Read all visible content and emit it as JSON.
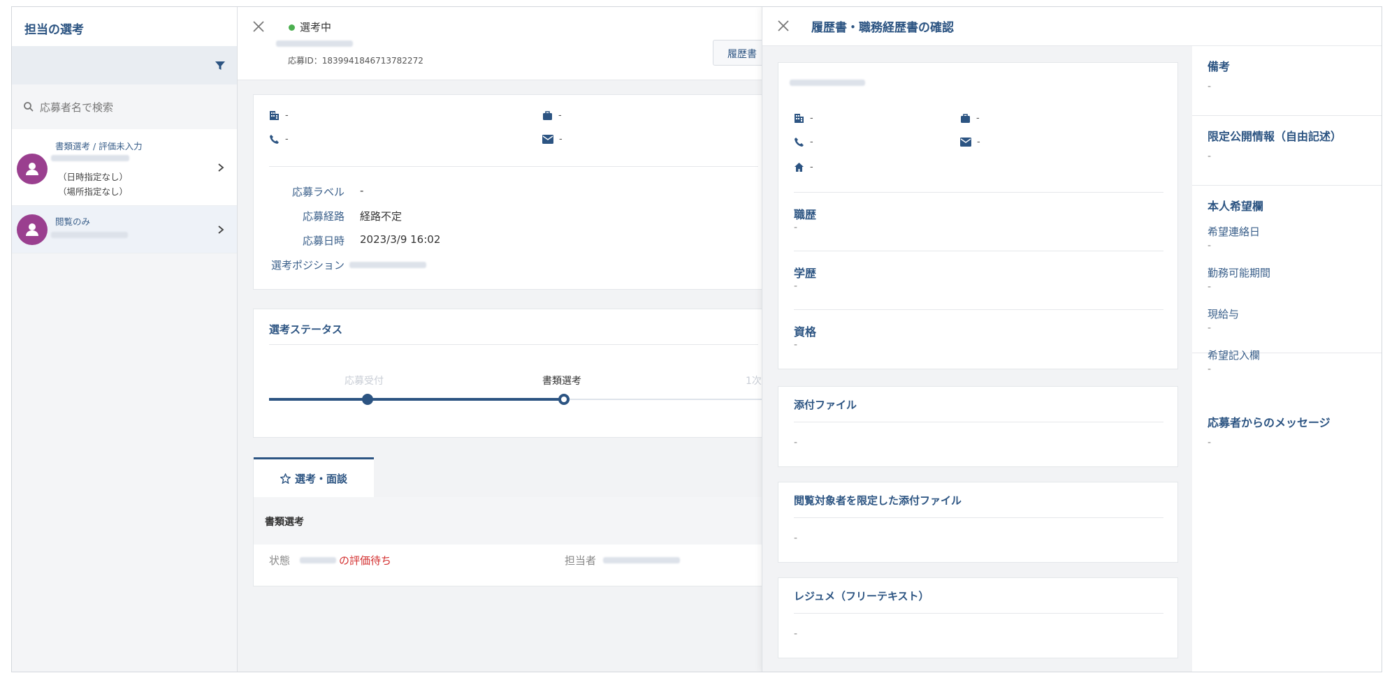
{
  "sidebar": {
    "title": "担当の選考",
    "search_placeholder": "応募者名で検索",
    "items": [
      {
        "status": "書類選考 / 評価未入力",
        "note1": "（日時指定なし）",
        "note2": "（場所指定なし）"
      },
      {
        "status": "閲覧のみ"
      }
    ]
  },
  "detail": {
    "status": "選考中",
    "application_id": "応募ID：1839941846713782272",
    "resume_button": "履歴書",
    "contact": {
      "company": "-",
      "job": "-",
      "phone": "-",
      "mail": "-"
    },
    "fields": [
      {
        "label": "応募ラベル",
        "value": "-"
      },
      {
        "label": "応募経路",
        "value": "経路不定"
      },
      {
        "label": "応募日時",
        "value": "2023/3/9 16:02"
      },
      {
        "label": "選考ポジション",
        "value": ""
      }
    ],
    "status_section": {
      "title": "選考ステータス",
      "steps": [
        "応募受付",
        "書類選考",
        "1次"
      ],
      "current_step": "書類選考"
    },
    "tab": "選考・面談",
    "stage_title": "書類選考",
    "state_label": "状態",
    "state_value": "の評価待ち",
    "owner_label": "担当者"
  },
  "overlay": {
    "title": "履歴書・職務経歴書の確認",
    "contact": {
      "company": "-",
      "job": "-",
      "phone": "-",
      "mail": "-",
      "home": "-"
    },
    "career": {
      "label": "職歴",
      "value": "-"
    },
    "education": {
      "label": "学歴",
      "value": "-"
    },
    "qualification": {
      "label": "資格",
      "value": "-"
    },
    "attachments": {
      "label": "添付ファイル",
      "value": "-"
    },
    "restricted_attachments": {
      "label": "閲覧対象者を限定した添付ファイル",
      "value": "-"
    },
    "resume_text": {
      "label": "レジュメ（フリーテキスト）",
      "value": "-"
    },
    "side": {
      "remarks": {
        "label": "備考",
        "value": "-"
      },
      "limited_info": {
        "label": "限定公開情報（自由記述）",
        "value": "-"
      },
      "wishes": {
        "label": "本人希望欄",
        "items": [
          {
            "label": "希望連絡日",
            "value": "-"
          },
          {
            "label": "勤務可能期間",
            "value": "-"
          },
          {
            "label": "現給与",
            "value": "-"
          },
          {
            "label": "希望記入欄",
            "value": "-"
          }
        ]
      },
      "message": {
        "label": "応募者からのメッセージ",
        "value": "-"
      }
    }
  },
  "colors": {
    "accent": "#2c5482",
    "status_green": "#4caf50",
    "avatar": "#9a3f8f",
    "warning_red": "#d32f2f"
  }
}
